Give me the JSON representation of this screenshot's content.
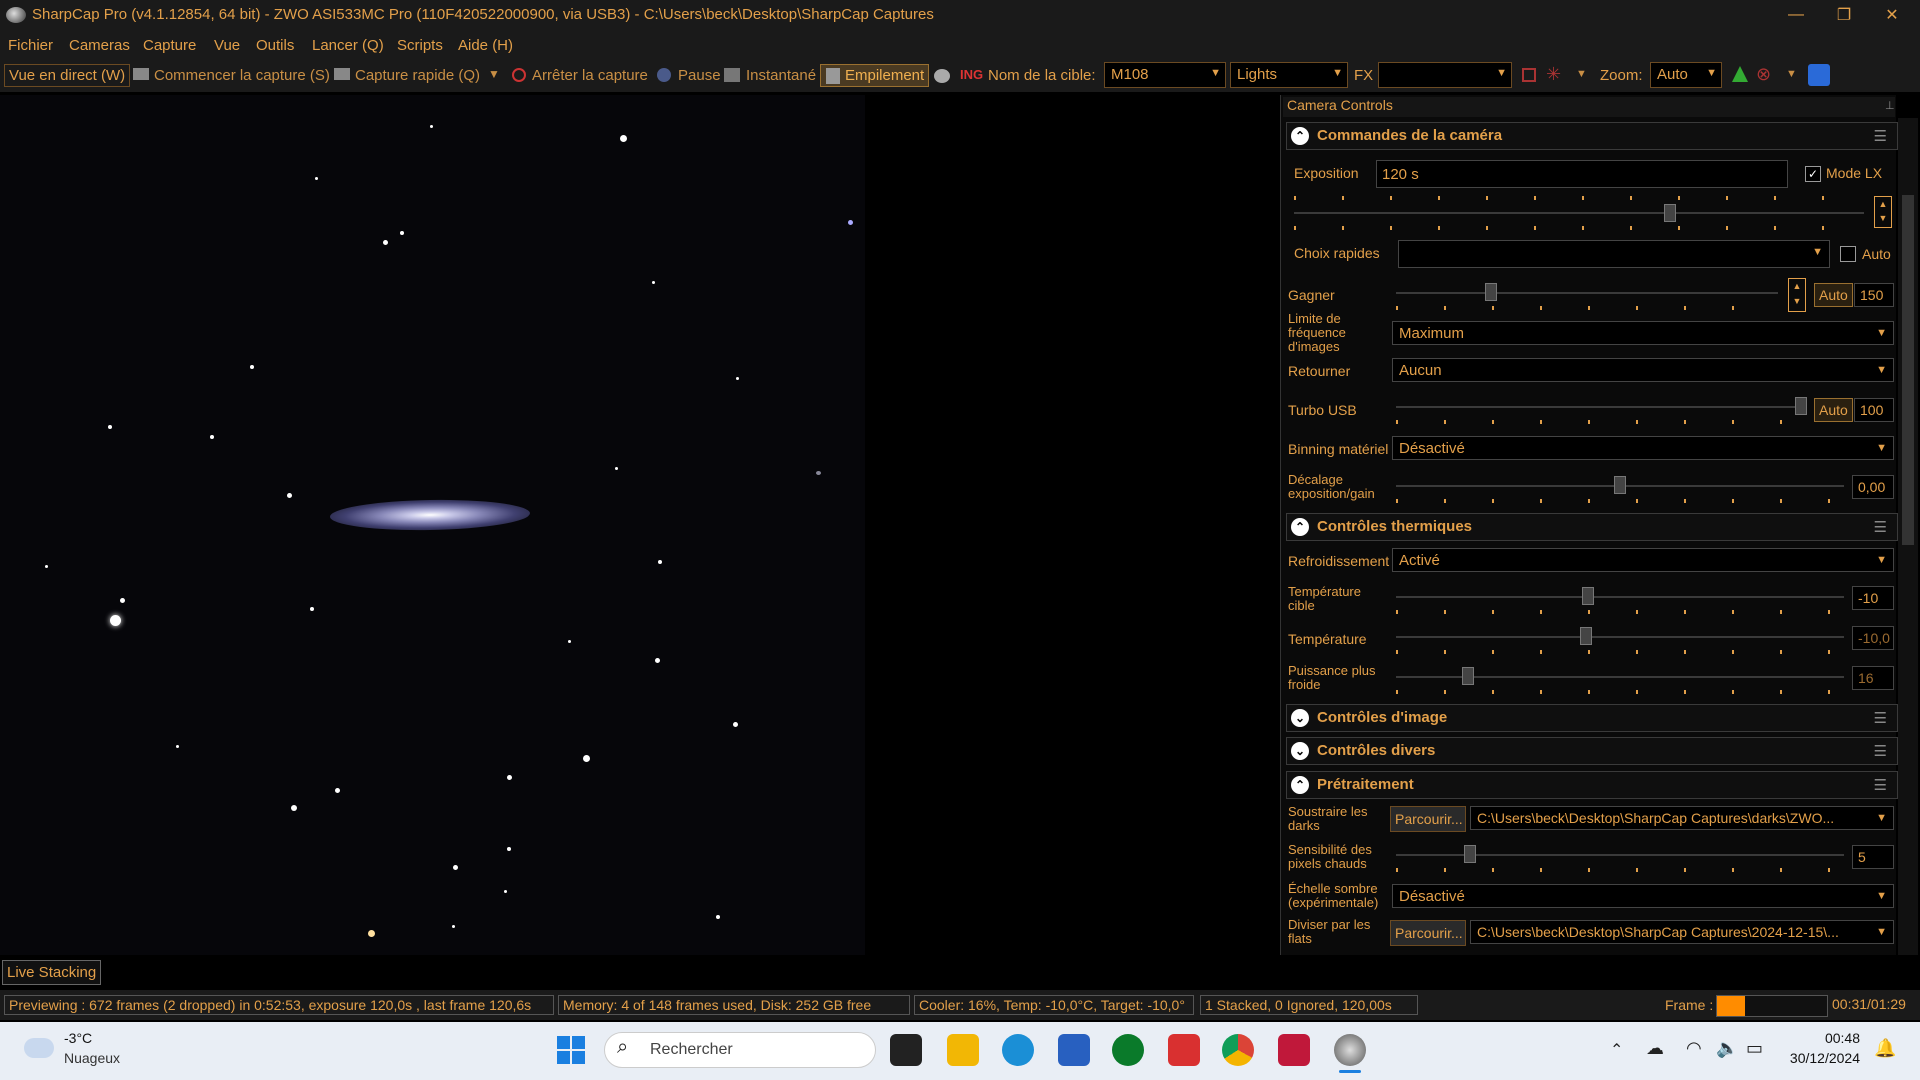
{
  "window": {
    "title": "SharpCap Pro (v4.1.12854, 64 bit) - ZWO ASI533MC Pro (110F420522000900, via USB3) - C:\\Users\\beck\\Desktop\\SharpCap Captures",
    "minimize": "—",
    "maximize": "❐",
    "close": "✕"
  },
  "menu": [
    "Fichier",
    "Cameras",
    "Capture",
    "Vue",
    "Outils",
    "Lancer (Q)",
    "Scripts",
    "Aide (H)"
  ],
  "toolbar": {
    "live_view": "Vue en direct (W)",
    "start_capture": "Commencer la capture (S)",
    "quick_capture": "Capture rapide (Q)",
    "stop_capture": "Arrêter la capture",
    "pause": "Pause",
    "snapshot": "Instantané",
    "stacking": "Empilement",
    "target_name_label": "Nom de la cible:",
    "target_name_value": "M108",
    "frame_type_value": "Lights",
    "fx_label": "FX",
    "fx_value": "",
    "zoom_label": "Zoom:",
    "zoom_value": "Auto"
  },
  "panel": {
    "header": "Camera Controls",
    "camera_controls": {
      "title": "Commandes de la caméra",
      "exposure_label": "Exposition",
      "exposure_value": "120 s",
      "lx_mode_label": "Mode LX",
      "lx_mode_checked": true,
      "quick_choice_label": "Choix rapides",
      "quick_choice_value": "",
      "auto_label": "Auto",
      "gain_label": "Gagner",
      "gain_auto": "Auto",
      "gain_value": "150",
      "frame_rate_label": "Limite de fréquence d'images",
      "frame_rate_value": "Maximum",
      "flip_label": "Retourner",
      "flip_value": "Aucun",
      "turbo_usb_label": "Turbo USB",
      "turbo_usb_auto": "Auto",
      "turbo_usb_value": "100",
      "binning_label": "Binning matériel",
      "binning_value": "Désactivé",
      "offset_label": "Décalage exposition/gain",
      "offset_value": "0,00"
    },
    "thermal": {
      "title": "Contrôles thermiques",
      "cooling_label": "Refroidissement",
      "cooling_value": "Activé",
      "target_temp_label": "Température cible",
      "target_temp_value": "-10",
      "temp_label": "Température",
      "temp_value": "-10,0",
      "power_label": "Puissance plus froide",
      "power_value": "16"
    },
    "image_controls": {
      "title": "Contrôles d'image"
    },
    "misc_controls": {
      "title": "Contrôles divers"
    },
    "preprocessing": {
      "title": "Prétraitement",
      "dark_label": "Soustraire les darks",
      "browse": "Parcourir...",
      "dark_value": "C:\\Users\\beck\\Desktop\\SharpCap Captures\\darks\\ZWO...",
      "hot_pixel_label": "Sensibilité des pixels chauds",
      "hot_pixel_value": "5",
      "dark_scale_label": "Échelle sombre (expérimentale)",
      "dark_scale_value": "Désactivé",
      "flat_label": "Diviser par les flats",
      "flat_value": "C:\\Users\\beck\\Desktop\\SharpCap Captures\\2024-12-15\\..."
    }
  },
  "live_stacking_tab": "Live Stacking",
  "status": {
    "preview": "Previewing : 672 frames (2 dropped) in 0:52:53, exposure 120,0s , last frame 120,6s",
    "memory": "Memory: 4 of 148 frames used, Disk: 252 GB free",
    "cooler": "Cooler: 16%, Temp: -10,0°C, Target: -10,0°",
    "stacked": "1 Stacked, 0 Ignored, 120,00s",
    "frame_label": "Frame :",
    "frame_progress": 0.25,
    "time": "00:31/01:29"
  },
  "taskbar": {
    "weather_temp": "-3°C",
    "weather_desc": "Nuageux",
    "search_placeholder": "Rechercher",
    "clock_time": "00:48",
    "clock_date": "30/12/2024"
  },
  "colors": {
    "accent": "#e3a04a",
    "background": "#1a1a1a",
    "taskbar": "#e9eef5"
  }
}
